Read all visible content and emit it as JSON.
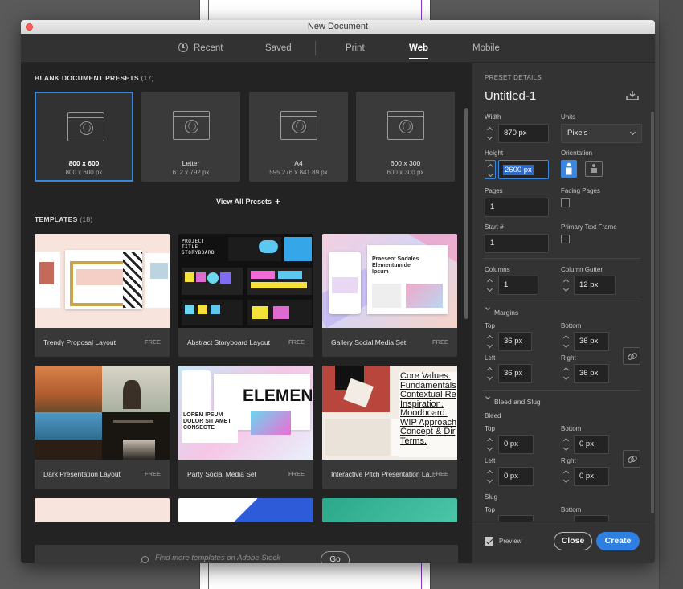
{
  "window": {
    "title": "New Document"
  },
  "tabs": [
    {
      "label": "Recent"
    },
    {
      "label": "Saved"
    },
    {
      "label": "Print"
    },
    {
      "label": "Web"
    },
    {
      "label": "Mobile"
    }
  ],
  "active_tab": "Web",
  "presets": {
    "heading": "BLANK DOCUMENT PRESETS",
    "count": "(17)",
    "items": [
      {
        "name": "800 x 600",
        "size": "800 x 600 px",
        "icon": "web-page-icon",
        "selected": true
      },
      {
        "name": "Letter",
        "size": "612 x 792 px",
        "icon": "web-page-icon"
      },
      {
        "name": "A4",
        "size": "595.276 x 841.89 px",
        "icon": "web-page-icon"
      },
      {
        "name": "600 x 300",
        "size": "600 x 300 px",
        "icon": "web-page-icon"
      }
    ],
    "view_all": "View All Presets"
  },
  "templates": {
    "heading": "TEMPLATES",
    "count": "(18)",
    "items": [
      {
        "name": "Trendy Proposal Layout",
        "badge": "FREE"
      },
      {
        "name": "Abstract Storyboard Layout",
        "badge": "FREE",
        "thumb_text": "PROJECT TITLE STORYBOARD"
      },
      {
        "name": "Gallery Social Media Set",
        "badge": "FREE",
        "thumb_text": "Praesent Sodales Elementum de Ipsum"
      },
      {
        "name": "Dark Presentation Layout",
        "badge": "FREE"
      },
      {
        "name": "Party Social Media Set",
        "badge": "FREE",
        "thumb_text": "ELEMENTUM",
        "thumb_text2": "LOREM IPSUM DOLOR SIT AMET CONSECTE"
      },
      {
        "name": "Interactive Pitch Presentation La...",
        "badge": "FREE",
        "thumb_text": "Core Values. Fundamentals Contextual Re Inspiration. Moodboard. WIP Approach Concept & Dir Terms."
      }
    ]
  },
  "search": {
    "placeholder": "Find more templates on Adobe Stock",
    "go_label": "Go"
  },
  "details": {
    "heading": "PRESET DETAILS",
    "doc_name": "Untitled-1",
    "width_label": "Width",
    "width": "870 px",
    "units_label": "Units",
    "units": "Pixels",
    "height_label": "Height",
    "height": "2600 px",
    "orientation_label": "Orientation",
    "pages_label": "Pages",
    "pages": "1",
    "facing_label": "Facing Pages",
    "start_label": "Start #",
    "start": "1",
    "primary_label": "Primary Text Frame",
    "columns_label": "Columns",
    "columns": "1",
    "gutter_label": "Column Gutter",
    "gutter": "12 px",
    "margins_label": "Margins",
    "m_top_label": "Top",
    "m_top": "36 px",
    "m_bottom_label": "Bottom",
    "m_bottom": "36 px",
    "m_left_label": "Left",
    "m_left": "36 px",
    "m_right_label": "Right",
    "m_right": "36 px",
    "bleed_slug_label": "Bleed and Slug",
    "bleed_label": "Bleed",
    "b_top_label": "Top",
    "b_top": "0 px",
    "b_bottom_label": "Bottom",
    "b_bottom": "0 px",
    "b_left_label": "Left",
    "b_left": "0 px",
    "b_right_label": "Right",
    "b_right": "0 px",
    "slug_label": "Slug",
    "s_top_label": "Top",
    "s_bottom_label": "Bottom"
  },
  "footer": {
    "preview_label": "Preview",
    "preview_checked": true,
    "close_label": "Close",
    "create_label": "Create"
  },
  "colors": {
    "accent": "#2e7fe0",
    "panel": "#323232",
    "gallery": "#232323"
  }
}
